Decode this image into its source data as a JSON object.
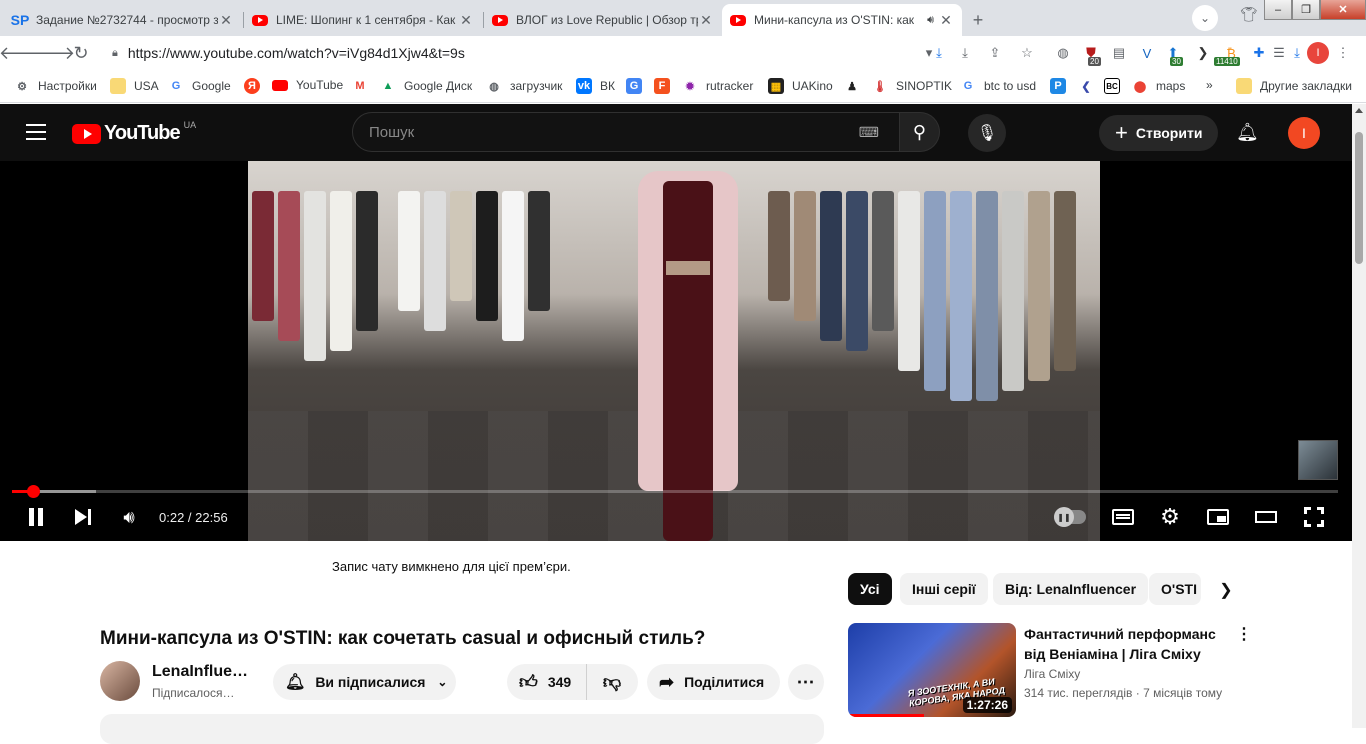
{
  "browser": {
    "tabs": [
      {
        "title": "Задание №2732744 - просмотр з",
        "favicon": "SP"
      },
      {
        "title": "LIME: Шопинг к 1 сентября - Как",
        "favicon": "youtube"
      },
      {
        "title": "ВЛОГ из Love Republic | Обзор тр",
        "favicon": "youtube"
      },
      {
        "title": "Мини-капсула из O'STIN: как",
        "favicon": "youtube"
      }
    ],
    "url": "https://www.youtube.com/watch?v=iVg84d1Xjw4&t=9s",
    "extension_badges": [
      "20",
      "30",
      "11410"
    ],
    "profile_initial": "I",
    "bookmarks": [
      {
        "label": "Настройки",
        "icon": "gear-icon"
      },
      {
        "label": "USA",
        "icon": "folder-icon"
      },
      {
        "label": "Google",
        "icon": "google-icon"
      },
      {
        "label": "",
        "icon": "yandex-icon"
      },
      {
        "label": "YouTube",
        "icon": "youtube-icon"
      },
      {
        "label": "",
        "icon": "gmail-icon"
      },
      {
        "label": "Google Диск",
        "icon": "drive-icon"
      },
      {
        "label": "загрузчик",
        "icon": "globe-icon"
      },
      {
        "label": "ВК",
        "icon": "vk-icon"
      },
      {
        "label": "",
        "icon": "translate-icon"
      },
      {
        "label": "",
        "icon": "feedly-icon"
      },
      {
        "label": "rutracker",
        "icon": "rutracker-icon"
      },
      {
        "label": "UAKino",
        "icon": "film-icon"
      },
      {
        "label": "",
        "icon": "chess-icon"
      },
      {
        "label": "SINOPTIK",
        "icon": "thermometer-icon"
      },
      {
        "label": "btc to usd",
        "icon": "google-icon"
      },
      {
        "label": "",
        "icon": "p-icon"
      },
      {
        "label": "",
        "icon": "arrow-icon"
      },
      {
        "label": "",
        "icon": "bc-icon"
      },
      {
        "label": "maps",
        "icon": "maps-icon"
      }
    ],
    "bookmarks_overflow": "»",
    "other_bookmarks": "Другие закладки"
  },
  "youtube": {
    "logo_text": "YouTube",
    "country_code": "UA",
    "search_placeholder": "Пошук",
    "create_label": "Створити",
    "avatar_initial": "I",
    "player": {
      "time_display": "0:22 / 22:56",
      "played_fraction": 0.016,
      "buffered_fraction": 0.063
    },
    "chat_notice": "Запис чату вимкнено для цієї прем’єри.",
    "video_title": "Мини-капсула из O'STIN: как сочетать casual и офисный стиль?",
    "channel_name": "LenaInflue…",
    "channel_subtext": "Підписалося…",
    "subscribe_label": "Ви підписалися",
    "like_count": "349",
    "share_label": "Поділитися",
    "chips": [
      "Усі",
      "Інші серії",
      "Від: LenaInfluencer",
      "O'STI"
    ],
    "recommendation": {
      "title": "Фантастичний перформанс від Веніаміна | Ліга Сміху",
      "channel": "Ліга Сміху",
      "meta": "314 тис. переглядів · 7 місяців тому",
      "duration": "1:27:26",
      "thumb_caption": "Я ЗООТЕХНІК, А ВИ КОРОВА, ЯКА НАРОД",
      "watched_fraction": 0.45
    }
  }
}
